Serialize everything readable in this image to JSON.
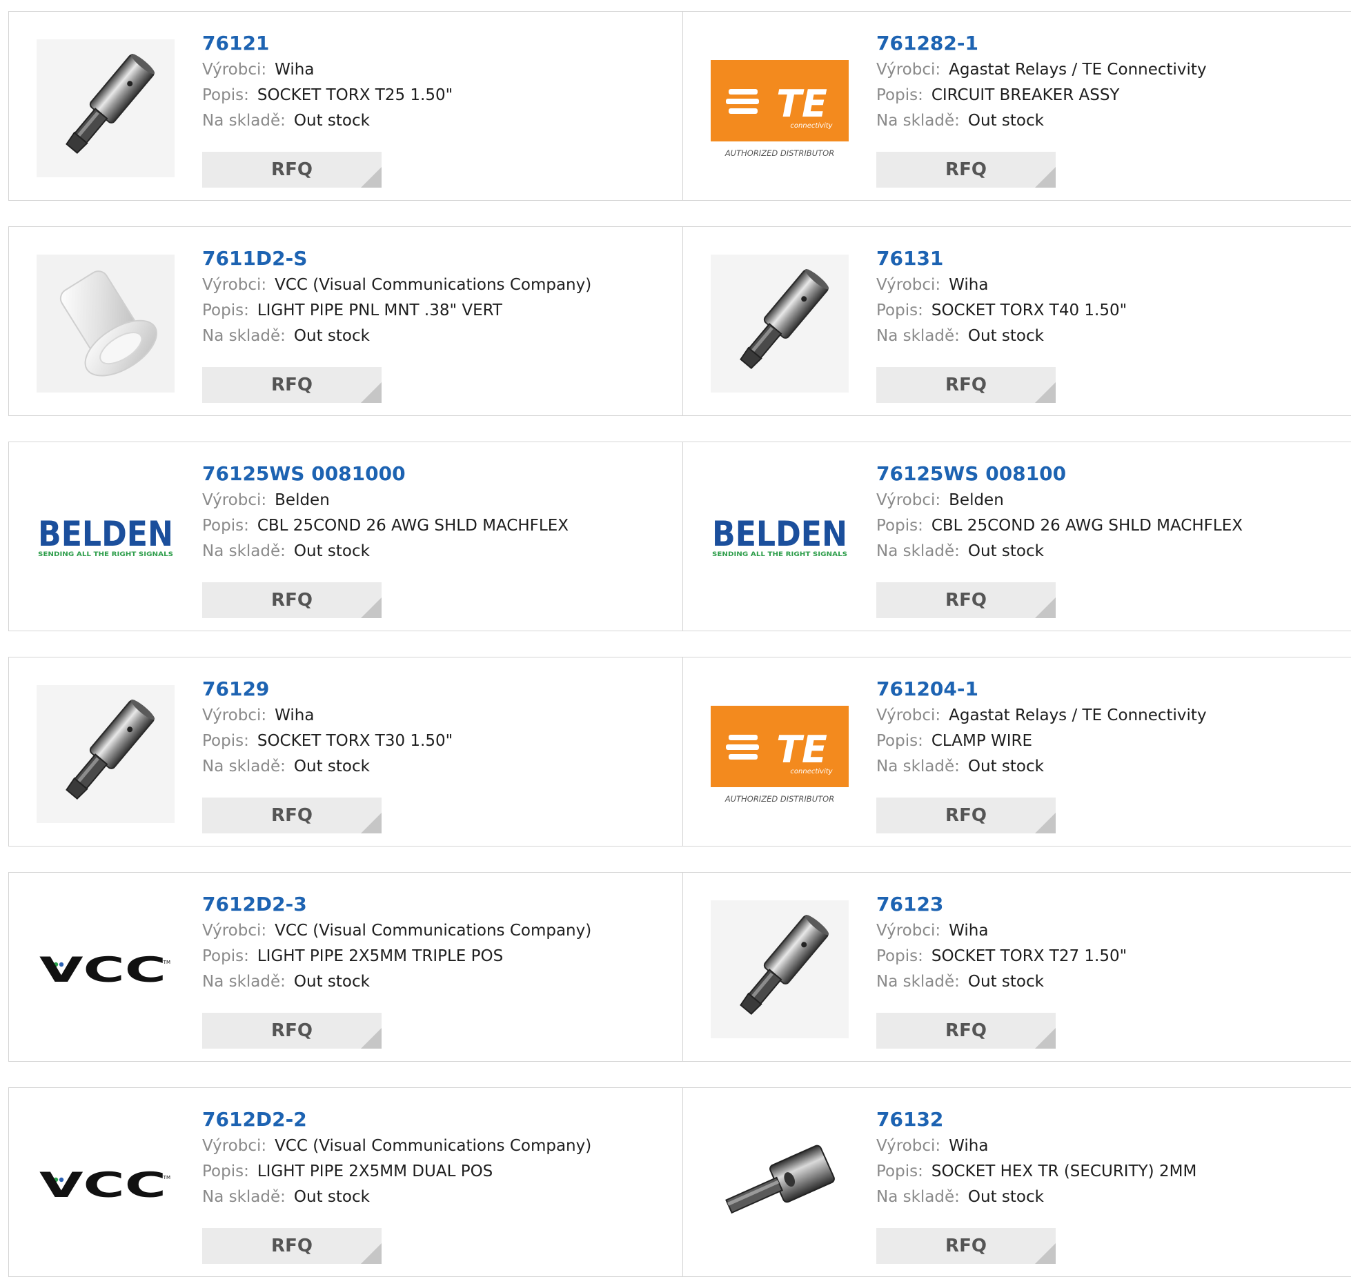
{
  "labels": {
    "manufacturer": "Výrobci:",
    "description": "Popis:",
    "stock": "Na skladě:",
    "rfq": "RFQ"
  },
  "colors": {
    "part_number_link": "#1d63b2",
    "label_text": "#8a8a8a",
    "rfq_button_bg": "#ebebeb",
    "te_orange": "#f38a1e",
    "belden_blue": "#1b4f9c",
    "belden_green": "#2e9e4b"
  },
  "products": [
    {
      "part_number": "76121",
      "manufacturer": "Wiha",
      "description": "SOCKET TORX T25 1.50\"",
      "stock": "Out stock",
      "image": "torx-socket"
    },
    {
      "part_number": "761282-1",
      "manufacturer": "Agastat Relays / TE Connectivity",
      "description": "CIRCUIT BREAKER ASSY",
      "stock": "Out stock",
      "image": "te-logo",
      "image_text": {
        "brand": "TE",
        "sub": "connectivity",
        "caption": "AUTHORIZED DISTRIBUTOR"
      }
    },
    {
      "part_number": "7611D2-S",
      "manufacturer": "VCC (Visual Communications Company)",
      "description": "LIGHT PIPE PNL MNT .38\" VERT",
      "stock": "Out stock",
      "image": "light-pipe"
    },
    {
      "part_number": "76131",
      "manufacturer": "Wiha",
      "description": "SOCKET TORX T40 1.50\"",
      "stock": "Out stock",
      "image": "torx-socket"
    },
    {
      "part_number": "76125WS 0081000",
      "manufacturer": "Belden",
      "description": "CBL 25COND 26 AWG SHLD MACHFLEX",
      "stock": "Out stock",
      "image": "belden-logo",
      "image_text": {
        "brand": "BELDEN",
        "tagline": "SENDING ALL THE RIGHT SIGNALS"
      }
    },
    {
      "part_number": "76125WS 008100",
      "manufacturer": "Belden",
      "description": "CBL 25COND 26 AWG SHLD MACHFLEX",
      "stock": "Out stock",
      "image": "belden-logo",
      "image_text": {
        "brand": "BELDEN",
        "tagline": "SENDING ALL THE RIGHT SIGNALS"
      }
    },
    {
      "part_number": "76129",
      "manufacturer": "Wiha",
      "description": "SOCKET TORX T30 1.50\"",
      "stock": "Out stock",
      "image": "torx-socket"
    },
    {
      "part_number": "761204-1",
      "manufacturer": "Agastat Relays / TE Connectivity",
      "description": "CLAMP WIRE",
      "stock": "Out stock",
      "image": "te-logo",
      "image_text": {
        "brand": "TE",
        "sub": "connectivity",
        "caption": "AUTHORIZED DISTRIBUTOR"
      }
    },
    {
      "part_number": "7612D2-3",
      "manufacturer": "VCC (Visual Communications Company)",
      "description": "LIGHT PIPE 2X5MM TRIPLE POS",
      "stock": "Out stock",
      "image": "vcc-logo",
      "image_text": {
        "brand": "VCC",
        "tm": "TM"
      }
    },
    {
      "part_number": "76123",
      "manufacturer": "Wiha",
      "description": "SOCKET TORX T27 1.50\"",
      "stock": "Out stock",
      "image": "torx-socket"
    },
    {
      "part_number": "7612D2-2",
      "manufacturer": "VCC (Visual Communications Company)",
      "description": "LIGHT PIPE 2X5MM DUAL POS",
      "stock": "Out stock",
      "image": "vcc-logo",
      "image_text": {
        "brand": "VCC",
        "tm": "TM"
      }
    },
    {
      "part_number": "76132",
      "manufacturer": "Wiha",
      "description": "SOCKET HEX TR (SECURITY) 2MM",
      "stock": "Out stock",
      "image": "hex-socket"
    }
  ]
}
